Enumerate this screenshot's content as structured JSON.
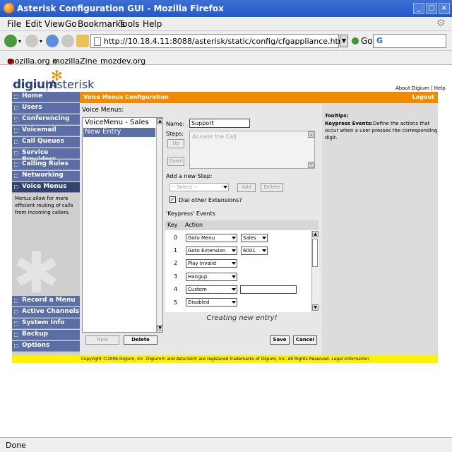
{
  "window": {
    "title": "Asterisk Configuration GUI - Mozilla Firefox",
    "min": "_",
    "max": "□",
    "close": "×"
  },
  "menu": [
    "File",
    "Edit",
    "View",
    "Go",
    "Bookmarks",
    "Tools",
    "Help"
  ],
  "nav": {
    "url": "http://10.18.4.11:8088/asterisk/static/config/cfgappliance.html",
    "go": "Go",
    "search_value": "G"
  },
  "bookmarks": [
    "mozilla.org",
    "mozillaZine",
    "mozdev.org"
  ],
  "logo": {
    "digium": "digium",
    "asterisk": "Asterisk",
    "star": "✻"
  },
  "toplinks": "About Digium  |  Help",
  "sidebar": {
    "items": [
      "Home",
      "Users",
      "Conferencing",
      "Voicemail",
      "Call Queues",
      "Service Providers",
      "Calling Rules",
      "Networking",
      "Voice Menus"
    ],
    "active_index": 8,
    "description": "Menus allow for more efficient routing of calls from incoming callers.",
    "lower_items": [
      "Record a Menu",
      "Active Channels",
      "System Info",
      "Backup",
      "Options"
    ]
  },
  "header": {
    "title": "Voice Menus Configuration",
    "logout": "Logout"
  },
  "voice_menus": {
    "label": "Voice Menus:",
    "options": [
      "VoiceMenu - Sales",
      "New Entry"
    ],
    "selected_index": 1,
    "new_label": "New",
    "delete_label": "Delete"
  },
  "form": {
    "name_label": "Name:",
    "name_value": "Support",
    "steps_label": "Steps:",
    "steps_value": "Answer the Call",
    "up_label": "Up",
    "down_label": "Down",
    "add_step_label": "Add a new Step:",
    "step_select": "-- Select --",
    "add_label": "Add",
    "delete_step_label": "Delete",
    "dial_other_label": "Dial other Extensions?",
    "dial_other_checked": true,
    "events_label": "'Keypress' Events",
    "key_header": "Key",
    "action_header": "Action",
    "events": [
      {
        "key": "0",
        "action": "Goto Menu",
        "arg": "Sales",
        "arg_type": "select"
      },
      {
        "key": "1",
        "action": "Goto Extension",
        "arg": "6001",
        "arg_type": "select"
      },
      {
        "key": "2",
        "action": "Play Invalid",
        "arg": "",
        "arg_type": "none"
      },
      {
        "key": "3",
        "action": "Hangup",
        "arg": "",
        "arg_type": "none"
      },
      {
        "key": "4",
        "action": "Custom",
        "arg": "",
        "arg_type": "text"
      },
      {
        "key": "5",
        "action": "Disabled",
        "arg": "",
        "arg_type": "none"
      }
    ],
    "status_text": "Creating new entry!",
    "save_label": "Save",
    "cancel_label": "Cancel"
  },
  "tips": {
    "heading": "Tooltips:",
    "term": "Keypress Events:",
    "text": "Define the actions that occur when a user presses the corresponding digit."
  },
  "footer": {
    "copyright": "Copyright ©2006 Digium, Inc. Digium® and Asterisk® are registered trademarks of Digium, Inc. All Rights Reserved.",
    "legal": "Legal Information"
  },
  "status": "Done",
  "colors": {
    "title_bar": "#2457c7",
    "header_orange": "#f08a00",
    "sidebar_blue": "#5b6fa6",
    "footer_yellow": "#fff200"
  }
}
